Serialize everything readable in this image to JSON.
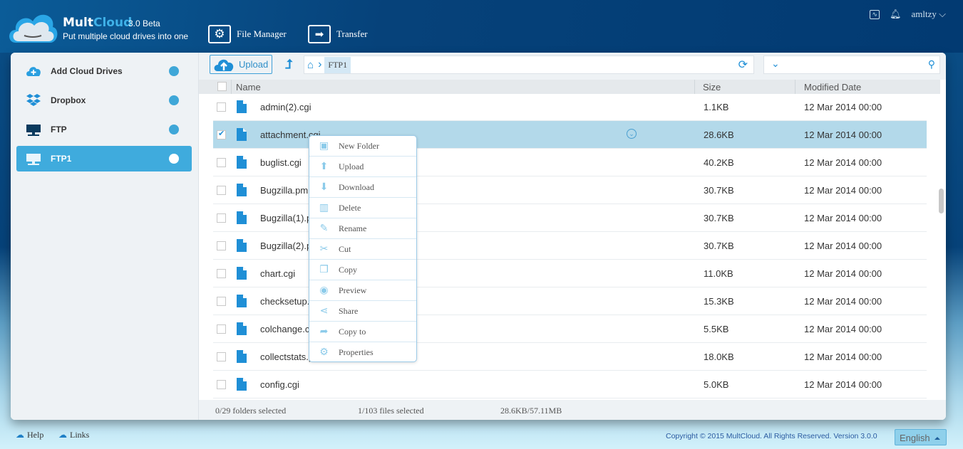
{
  "header": {
    "brand_a": "Mult",
    "brand_b": "Cloud",
    "version": "3.0 Beta",
    "tagline": "Put multiple cloud drives into one",
    "nav": [
      {
        "label": "File Manager",
        "icon": "gear-icon"
      },
      {
        "label": "Transfer",
        "icon": "arrow-right-icon"
      }
    ],
    "username": "amltzy"
  },
  "sidebar": {
    "items": [
      {
        "label": "Add Cloud Drives",
        "icon": "cloud-plus-icon"
      },
      {
        "label": "Dropbox",
        "icon": "dropbox-icon"
      },
      {
        "label": "FTP",
        "icon": "ftp-icon"
      },
      {
        "label": "FTP1",
        "icon": "ftp-icon",
        "active": true
      }
    ]
  },
  "toolbar": {
    "upload_label": "Upload",
    "breadcrumb": "FTP1",
    "search_placeholder": ""
  },
  "table": {
    "columns": [
      "Name",
      "Size",
      "Modified Date"
    ],
    "rows": [
      {
        "name": "admin(2).cgi",
        "size": "1.1KB",
        "date": "12 Mar 2014 00:00",
        "checked": false
      },
      {
        "name": "attachment.cgi",
        "size": "28.6KB",
        "date": "12 Mar 2014 00:00",
        "checked": true
      },
      {
        "name": "buglist.cgi",
        "size": "40.2KB",
        "date": "12 Mar 2014 00:00",
        "checked": false
      },
      {
        "name": "Bugzilla.pm",
        "size": "30.7KB",
        "date": "12 Mar 2014 00:00",
        "checked": false
      },
      {
        "name": "Bugzilla(1).pm",
        "size": "30.7KB",
        "date": "12 Mar 2014 00:00",
        "checked": false
      },
      {
        "name": "Bugzilla(2).pm",
        "size": "30.7KB",
        "date": "12 Mar 2014 00:00",
        "checked": false
      },
      {
        "name": "chart.cgi",
        "size": "11.0KB",
        "date": "12 Mar 2014 00:00",
        "checked": false
      },
      {
        "name": "checksetup.pl",
        "size": "15.3KB",
        "date": "12 Mar 2014 00:00",
        "checked": false
      },
      {
        "name": "colchange.cgi",
        "size": "5.5KB",
        "date": "12 Mar 2014 00:00",
        "checked": false
      },
      {
        "name": "collectstats.pl",
        "size": "18.0KB",
        "date": "12 Mar 2014 00:00",
        "checked": false
      },
      {
        "name": "config.cgi",
        "size": "5.0KB",
        "date": "12 Mar 2014 00:00",
        "checked": false
      }
    ]
  },
  "context_menu": [
    {
      "label": "New Folder",
      "icon": "new-folder-icon",
      "glyph": "▣"
    },
    {
      "label": "Upload",
      "icon": "upload-icon",
      "glyph": "⬆"
    },
    {
      "label": "Download",
      "icon": "download-icon",
      "glyph": "⬇"
    },
    {
      "label": "Delete",
      "icon": "trash-icon",
      "glyph": "▥"
    },
    {
      "label": "Rename",
      "icon": "pencil-icon",
      "glyph": "✎"
    },
    {
      "label": "Cut",
      "icon": "scissors-icon",
      "glyph": "✂"
    },
    {
      "label": "Copy",
      "icon": "copy-icon",
      "glyph": "❐"
    },
    {
      "label": "Preview",
      "icon": "eye-icon",
      "glyph": "◉"
    },
    {
      "label": "Share",
      "icon": "share-icon",
      "glyph": "⋖"
    },
    {
      "label": "Copy to",
      "icon": "copy-to-icon",
      "glyph": "➦"
    },
    {
      "label": "Properties",
      "icon": "gear-icon",
      "glyph": "⚙"
    }
  ],
  "status": {
    "folders": "0/29 folders selected",
    "files": "1/103 files selected",
    "size": "28.6KB/57.11MB"
  },
  "footer": {
    "help": "Help",
    "links": "Links",
    "copyright": "Copyright © 2015 MultCloud. All Rights Reserved. Version 3.0.0",
    "language": "English"
  },
  "colors": {
    "accent": "#3fabdd",
    "header": "#06427a",
    "selected_row": "#b3d9ea"
  }
}
